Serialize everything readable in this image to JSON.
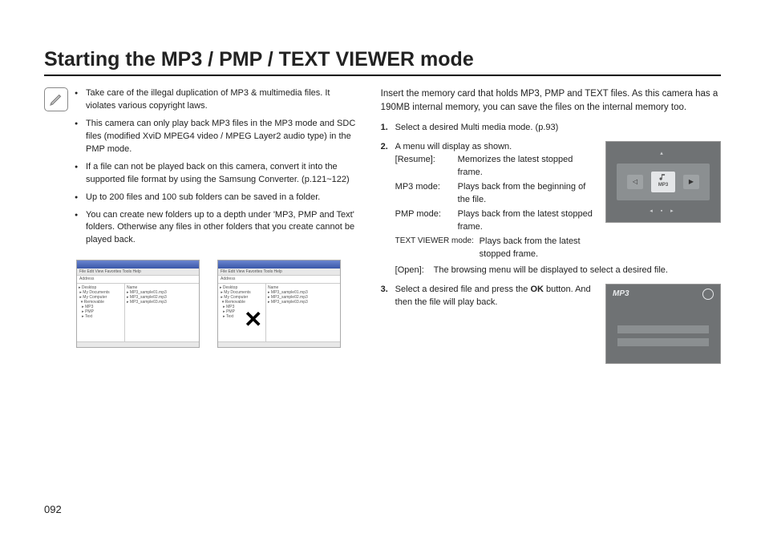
{
  "title": "Starting the MP3 / PMP / TEXT VIEWER mode",
  "page_number": "092",
  "left_notes": [
    "Take care of the illegal duplication of MP3 & multimedia files. It violates various copyright laws.",
    "This camera can only play back MP3 files in the MP3 mode and SDC files (modified XviD MPEG4 video / MPEG Layer2 audio type) in the PMP mode.",
    "If a file can not be played back on this camera, convert it into the supported file format by using the Samsung Converter. (p.121~122)",
    "Up to 200 files and 100 sub folders can be saved in a folder.",
    "You can create new folders up to a depth under 'MP3, PMP and Text' folders. Otherwise any files in other folders that you create cannot be played back."
  ],
  "explorer": {
    "menu": "File  Edit  View  Favorites  Tools  Help",
    "address_label": "Address",
    "sample_tree": "▸ Desktop\n ▸ My Documents\n ▸ My Computer\n  ▾ Removable\n   ▸ MP3\n   ▸ PMP\n   ▸ Text",
    "sample_files": "Name\n▸ MP3_sample01.mp3\n▸ MP3_sample02.mp3\n▸ MP3_sample03.mp3"
  },
  "intro": "Insert the memory card that holds MP3, PMP and TEXT files. As this camera has a 190MB internal memory, you can save the files on the internal memory too.",
  "steps": {
    "s1": "Select a desired Multi media mode. (p.93)",
    "s2_lead": "A menu will display as shown.",
    "s2_defs": {
      "resume_key": "[Resume]:",
      "resume_val": "Memorizes the latest stopped frame.",
      "mp3_key": "MP3 mode:",
      "mp3_val": "Plays back from the beginning of the file.",
      "pmp_key": "PMP mode:",
      "pmp_val": "Plays back from the latest stopped frame.",
      "text_key": "TEXT VIEWER mode:",
      "text_val": "Plays back from the latest stopped frame.",
      "open_key": "[Open]:",
      "open_val": "The browsing menu will be displayed to select a desired file."
    },
    "s3_a": "Select a desired file and press the ",
    "s3_ok": "OK",
    "s3_b": " button. And then the file will play back."
  },
  "lcd": {
    "tile_label": "MP3",
    "mp3_label": "MP3"
  }
}
